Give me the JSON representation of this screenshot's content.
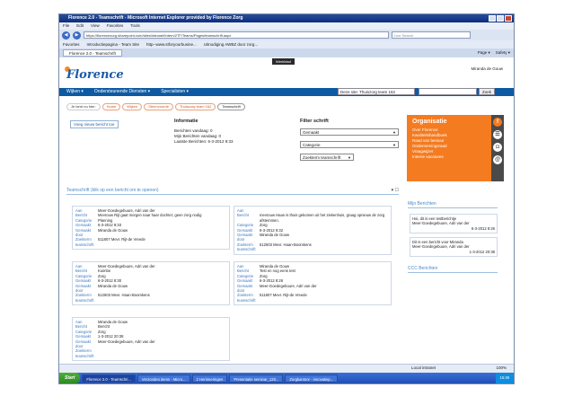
{
  "browser": {
    "title": "Florence 2.0 - Teamschrift - Microsoft Internet Explorer provided by Florence Zorg",
    "menu": [
      "File",
      "Edit",
      "View",
      "Favorites",
      "Tools"
    ],
    "address": "https://florencezorg.sharepoint.com/sites/intranet/Intern/2TF/Teams/Pages/teamschrift.aspx",
    "search_placeholder": "Live Search",
    "favorites_label": "Favorites",
    "favorites": [
      "Introductiepagina - Team Site",
      "http--www.stforyourbusine...",
      "Uitnodiging AWBZ door zorg..."
    ],
    "tab": "Florence 2.0 - Teamschrift",
    "tools": [
      "Page ▾",
      "Safety ▾"
    ]
  },
  "site": {
    "werkblad": "Werkblad",
    "logo": "Florence",
    "user": "Miranda de Gouw",
    "nav": [
      "Wijken ▾",
      "Ondersteunende Diensten ▾",
      "Specialisten ▾"
    ],
    "site_select": "Deze site: Thuiszorg team 162",
    "search_button": "Zoek",
    "breadcrumbs": [
      "Je bent nu hier:",
      "Home",
      "Wijken",
      "Steenvoorde",
      "Thuiszorg team 162",
      "Teamschrift"
    ],
    "new_button": "Voeg nieuw bericht toe"
  },
  "info": {
    "title": "Informatie",
    "lines": [
      "Berichten vandaag: 0",
      "Mijn Berichten vandaag: 0",
      "Laatste Berichten: 6-3-2012 9:33"
    ]
  },
  "filter": {
    "title": "Filter schrift",
    "options": [
      "Gemaakt",
      "Categorie",
      "Zoekterm teamschrift"
    ]
  },
  "org": {
    "title": "Organisatie",
    "items": [
      "Over Florence",
      "Kwaliteitshandboek",
      "Raad van bestuur",
      "Ondernemingsraad",
      "Vraagwijzer",
      "Interne vacatures"
    ]
  },
  "teamschrift": {
    "title": "Teamschrift (klik op een bericht om te openen)",
    "controls": "▾ ☐",
    "labels": {
      "aan": "Aan",
      "bericht": "Bericht",
      "categorie": "Categorie",
      "gemaakt": "Gemaakt",
      "door": "Gemaakt door",
      "zoekterm": "Zoekterm teamschrift"
    },
    "cards": [
      {
        "aan": "Meer-Goedegebuure, Adri van der",
        "bericht": "Mevrouw Rijt gaat morgen naar haar dochter; geen zorg nodig",
        "categorie": "Planning",
        "gemaakt": "6-3-2012 9:33",
        "door": "Miranda de Gouw",
        "zoekterm": "511807 Mevr. Rijt-de Vreede"
      },
      {
        "aan": "",
        "bericht": "mevrouw Haan is thuis gekomen uit het ziekenhuis, graag opnieuw de zorg afstemmen.",
        "categorie": "Zorg",
        "gemaakt": "6-3-2012 9:32",
        "door": "Miranda de Gouw",
        "zoekterm": "512603 Mevr. Haan-Boomkens"
      },
      {
        "aan": "Meer-Goedegebuure, Adri van der",
        "bericht": "Kuimbe",
        "categorie": "Zorg",
        "gemaakt": "6-3-2012 8:30",
        "door": "Miranda de Gouw",
        "zoekterm": "512603 Mevr. Haan-Boomkens"
      },
      {
        "aan": "Miranda de Gouw",
        "bericht": "Test en nog eens test",
        "categorie": "Zorg",
        "gemaakt": "6-3-2012 8:26",
        "door": "Meer-Goedegebuure, Adri van der",
        "zoekterm": "511807 Mevr. Rijt-de Vreede"
      },
      {
        "aan": "Miranda de Gouw",
        "bericht": "Bericht",
        "categorie": "Zorg",
        "gemaakt": "1-3-2012 20:38",
        "door": "Meer-Goedegebuure, Adri van der",
        "zoekterm": ""
      }
    ]
  },
  "mijn_berichten": {
    "title": "Mijn Berichten",
    "posts": [
      {
        "text": "Hoi, dit is een testberichtje",
        "from": "Meer-Goedegebuure, Adri van der",
        "date": "6-3-2012 8:26"
      },
      {
        "text": "Dit is een bericht voor Miranda",
        "from": "Meer-Goedegebuure, Adri van der",
        "date": "1-3-2012 20:38"
      }
    ]
  },
  "ccc": {
    "title": "CCC Berichten"
  },
  "status": {
    "zone": "Local intranet",
    "zoom": "100%"
  },
  "taskbar": {
    "start": "Start",
    "items": [
      "Florence 2.0 - Teamschri...",
      "Verzonden items - Micro...",
      "2 Herinneringen",
      "Presentatie seminar_120...",
      "Zorgkantoor - innovatiep..."
    ],
    "time": "15:49"
  }
}
